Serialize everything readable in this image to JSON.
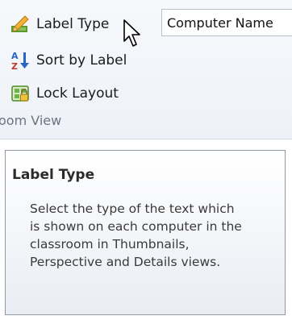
{
  "ribbon": {
    "label_type_label": "Label Type",
    "sort_label": "Sort by Label",
    "lock_label": "Lock Layout",
    "combo_value": "Computer Name",
    "group_label": "oom View"
  },
  "tooltip": {
    "title": "Label Type",
    "description": "Select the type of the text which is shown on each computer in the classroom in Thumbnails, Perspective and Details views."
  },
  "icons": {
    "label_type": "pencil-icon",
    "sort": "sort-az-icon",
    "lock": "lock-icon",
    "cursor": "mouse-cursor-icon"
  },
  "colors": {
    "accent_green": "#5a9a2c",
    "accent_blue": "#2a64c9",
    "tooltip_border": "#8f98a4"
  }
}
